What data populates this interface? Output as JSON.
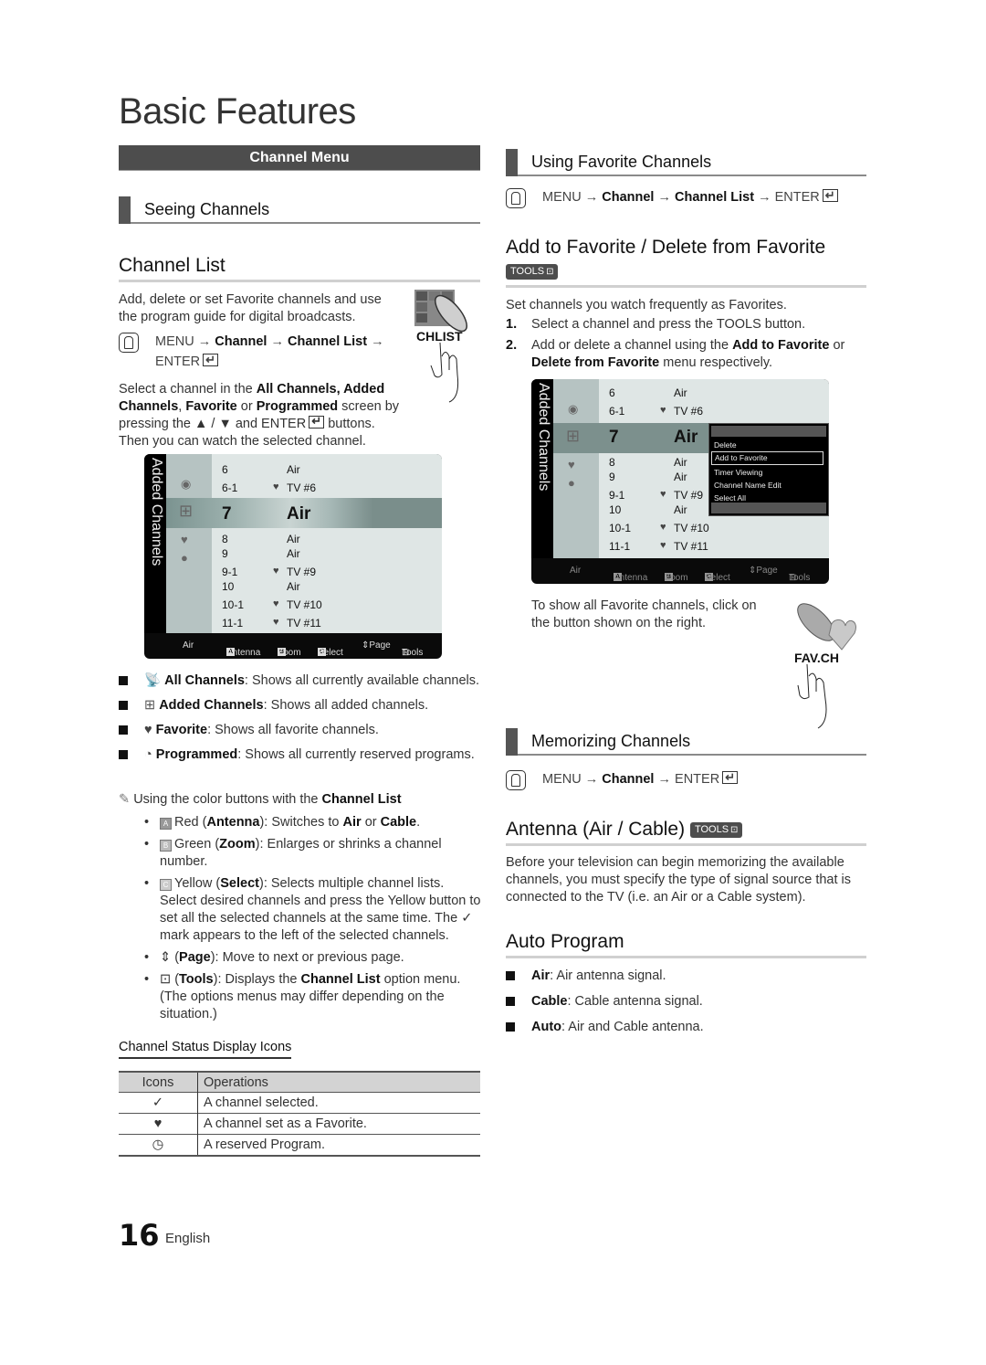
{
  "page": {
    "title": "Basic Features",
    "page_number": "16",
    "language": "English"
  },
  "left": {
    "chapter": "Channel Menu",
    "sub_heading": "Seeing Channels",
    "section_title": "Channel List",
    "intro": "Add, delete or set Favorite channels and use the program guide for digital broadcasts.",
    "menu_path": {
      "menu": "MENU",
      "arrow": "→",
      "channel": "Channel",
      "channel_list": "Channel List",
      "enter": "ENTER"
    },
    "chlist_label": "CHLIST",
    "select_text": {
      "p1": "Select a channel in the ",
      "b1": "All Channels, Added Channels",
      "p2": ", ",
      "b2": "Favorite",
      "p3": " or ",
      "b3": "Programmed",
      "p4": " screen by pressing the ▲ / ▼ and ENTER",
      "p5": " buttons. Then you can watch the selected channel."
    },
    "categories": [
      {
        "icon": "all-channels-icon",
        "glyph": "📡",
        "label": "All Channels",
        "desc": ": Shows all currently available channels."
      },
      {
        "icon": "added-channels-icon",
        "glyph": "⊞",
        "label": "Added Channels",
        "desc": ": Shows all added channels."
      },
      {
        "icon": "favorite-heart-icon",
        "glyph": "♥",
        "label": "Favorite",
        "desc": ": Shows all favorite channels."
      },
      {
        "icon": "programmed-timer-icon",
        "glyph": "◔",
        "label": "Programmed",
        "desc": ": Shows all currently reserved programs."
      }
    ],
    "note": {
      "text": "Using the color buttons with the ",
      "bold": "Channel List"
    },
    "color_buttons": [
      {
        "key": "A",
        "pre": "Red (",
        "bold": "Antenna",
        "post": "): Switches to ",
        "b2": "Air",
        "mid": " or ",
        "b3": "Cable",
        "end": "."
      },
      {
        "key": "B",
        "pre": "Green (",
        "bold": "Zoom",
        "post": "): Enlarges or shrinks a channel number."
      },
      {
        "key": "C",
        "pre": "Yellow (",
        "bold": "Select",
        "post": "): Selects multiple channel lists. Select desired channels and press the Yellow button to set all the selected channels at the same time. The ",
        "check": "✓",
        "end": " mark appears to the left of the selected channels."
      },
      {
        "key": "⇕",
        "pre": "(",
        "bold": "Page",
        "post": "): Move to next or previous page."
      },
      {
        "key": "⊡",
        "pre": "(",
        "bold": "Tools",
        "post": "): Displays the ",
        "b2": "Channel List",
        "end": " option menu. (The options menus may differ depending on the situation.)"
      }
    ],
    "status_table": {
      "title": "Channel Status Display Icons",
      "headers": [
        "Icons",
        "Operations"
      ],
      "rows": [
        {
          "icon": "✓",
          "icon_name": "check-icon",
          "op": "A channel selected."
        },
        {
          "icon": "♥",
          "icon_name": "heart-icon",
          "op": "A channel set as a Favorite."
        },
        {
          "icon": "◷",
          "icon_name": "clock-icon",
          "op": "A reserved Program."
        }
      ]
    }
  },
  "tv_screen": {
    "side_label": "Added Channels",
    "channels": [
      {
        "num": "6",
        "fav": false,
        "name": "Air"
      },
      {
        "num": "6-1",
        "fav": true,
        "name": "TV #6"
      },
      {
        "num": "7",
        "fav": false,
        "name": "Air",
        "selected": true
      },
      {
        "num": "8",
        "fav": false,
        "name": "Air"
      },
      {
        "num": "9",
        "fav": false,
        "name": "Air"
      },
      {
        "num": "9-1",
        "fav": true,
        "name": "TV #9"
      },
      {
        "num": "10",
        "fav": false,
        "name": "Air"
      },
      {
        "num": "10-1",
        "fav": true,
        "name": "TV #10"
      },
      {
        "num": "11-1",
        "fav": true,
        "name": "TV #11"
      }
    ],
    "footer": {
      "source": "Air",
      "antenna_key": "A",
      "antenna": "Antenna",
      "zoom_key": "B",
      "zoom": "Zoom",
      "select_key": "C",
      "select": "Select",
      "page": "⇕Page",
      "tools": "Tools"
    },
    "tools_menu": [
      "Delete",
      "Add to Favorite",
      "Timer Viewing",
      "Channel Name Edit",
      "Select All"
    ],
    "tools_menu_selected": "Add to Favorite"
  },
  "right": {
    "sub_heading_fav": "Using Favorite Channels",
    "fav_menu_path": {
      "menu": "MENU",
      "arrow": "→",
      "channel": "Channel",
      "channel_list": "Channel List",
      "enter": "ENTER"
    },
    "fav_section_title": "Add to Favorite / Delete from Favorite",
    "tools_badge": "TOOLS",
    "fav_intro": "Set channels you watch frequently as Favorites.",
    "steps": [
      {
        "n": "1.",
        "pre": "Select a channel and press the ",
        "bold": "TOOLS",
        "post": " button."
      },
      {
        "n": "2.",
        "pre": "Add or delete a channel using the ",
        "bold": "Add to Favorite",
        "mid": " or ",
        "bold2": "Delete from Favorite",
        "post": " menu respectively."
      }
    ],
    "favch_text": "To show all Favorite channels, click on the button shown on the right.",
    "favch_label": "FAV.CH",
    "sub_heading_mem": "Memorizing Channels",
    "mem_menu_path": {
      "menu": "MENU",
      "arrow": "→",
      "channel": "Channel",
      "enter": "ENTER"
    },
    "antenna_title": "Antenna (Air / Cable)",
    "antenna_text": "Before your television can begin memorizing the available channels, you must specify the type of signal source that is connected to the TV (i.e. an Air or a Cable system).",
    "auto_title": "Auto Program",
    "auto_items": [
      {
        "bold": "Air",
        "desc": ": Air antenna signal."
      },
      {
        "bold": "Cable",
        "desc": ": Cable antenna signal."
      },
      {
        "bold": "Auto",
        "desc": ": Air and Cable antenna."
      }
    ]
  }
}
